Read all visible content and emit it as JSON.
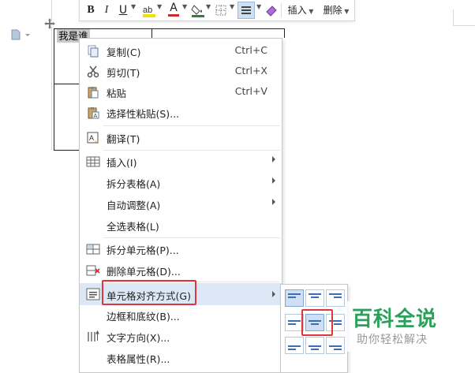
{
  "colors": {
    "highlight_row": "#dde8f6",
    "annotation_red": "#e0353a",
    "align_icon_blue": "#3a6fb3",
    "watermark_green": "#2aa05a"
  },
  "document": {
    "cell_text": "我是谁",
    "move_handle_icon": "move-handle-icon",
    "side_icon": "document-icon"
  },
  "toolbar": {
    "bold": "B",
    "italic": "I",
    "underline": "U",
    "font_color": "A",
    "insert_label": "插入",
    "delete_label": "删除"
  },
  "menu": {
    "items": [
      {
        "label": "复制(C)",
        "shortcut": "Ctrl+C",
        "icon": "copy-icon"
      },
      {
        "label": "剪切(T)",
        "shortcut": "Ctrl+X",
        "icon": "cut-icon"
      },
      {
        "label": "粘贴",
        "shortcut": "Ctrl+V",
        "icon": "paste-icon"
      },
      {
        "label": "选择性粘贴(S)...",
        "icon": "paste-special-icon"
      },
      {
        "label": "翻译(T)",
        "icon": "translate-icon"
      },
      {
        "label": "插入(I)",
        "icon": "table-insert-icon",
        "submenu": true
      },
      {
        "label": "拆分表格(A)",
        "submenu": true
      },
      {
        "label": "自动调整(A)",
        "submenu": true
      },
      {
        "label": "全选表格(L)"
      },
      {
        "label": "拆分单元格(P)...",
        "icon": "split-cells-icon"
      },
      {
        "label": "删除单元格(D)...",
        "icon": "delete-cells-icon"
      },
      {
        "label": "单元格对齐方式(G)",
        "icon": "cell-align-icon",
        "submenu": true,
        "highlighted": true
      },
      {
        "label": "边框和底纹(B)..."
      },
      {
        "label": "文字方向(X)...",
        "icon": "text-direction-icon"
      },
      {
        "label": "表格属性(R)..."
      }
    ]
  },
  "align_submenu": {
    "selected_index": 4,
    "options": [
      "top-left",
      "top-center",
      "top-right",
      "middle-left",
      "middle-center",
      "middle-right",
      "bottom-left",
      "bottom-center",
      "bottom-right"
    ]
  },
  "watermark": {
    "title": "百科全说",
    "subtitle": "助你轻松解决"
  }
}
